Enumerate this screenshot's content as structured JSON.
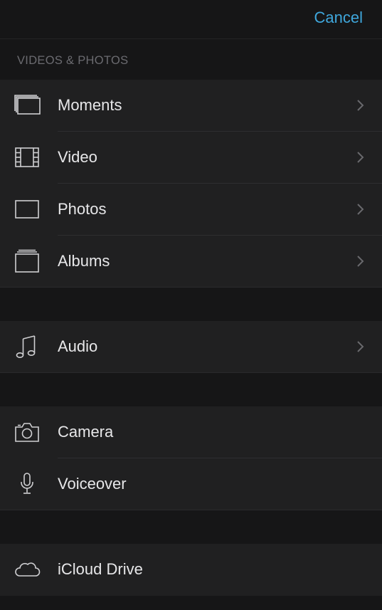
{
  "header": {
    "cancel_label": "Cancel"
  },
  "sections": {
    "videos_photos_title": "VIDEOS & PHOTOS"
  },
  "media_items": [
    {
      "label": "Moments",
      "icon": "moments-icon"
    },
    {
      "label": "Video",
      "icon": "film-icon"
    },
    {
      "label": "Photos",
      "icon": "photo-frame-icon"
    },
    {
      "label": "Albums",
      "icon": "albums-icon"
    }
  ],
  "audio_items": [
    {
      "label": "Audio",
      "icon": "music-note-icon"
    }
  ],
  "capture_items": [
    {
      "label": "Camera",
      "icon": "camera-icon"
    },
    {
      "label": "Voiceover",
      "icon": "microphone-icon"
    }
  ],
  "cloud_items": [
    {
      "label": "iCloud Drive",
      "icon": "cloud-icon"
    }
  ],
  "colors": {
    "accent": "#3fa7dc",
    "background": "#161617",
    "row_background": "#202021",
    "text": "#e7e7e9",
    "section_header": "#6b6b70"
  }
}
